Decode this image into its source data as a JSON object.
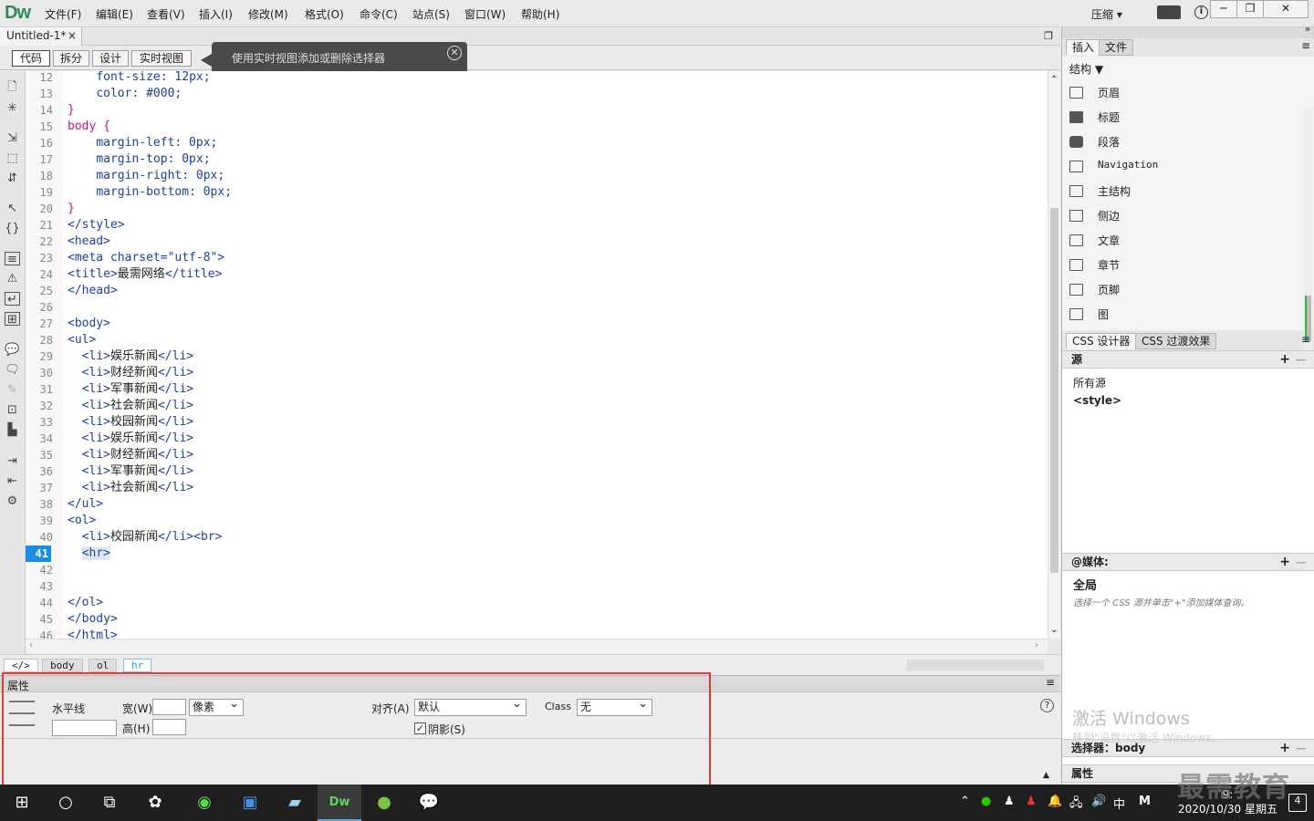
{
  "app": {
    "logo": "Dw"
  },
  "menu": [
    "文件(F)",
    "编辑(E)",
    "查看(V)",
    "插入(I)",
    "修改(M)",
    "格式(O)",
    "命令(C)",
    "站点(S)",
    "窗口(W)",
    "帮助(H)"
  ],
  "window": {
    "compress": "压缩",
    "compress_arrow": "▾",
    "min": "─",
    "max": "❐",
    "close": "✕"
  },
  "document": {
    "tab": "Untitled-1*",
    "tab_close": "×"
  },
  "viewbar": {
    "code": "代码",
    "split": "拆分",
    "design": "设计",
    "live": "实时视图"
  },
  "tooltip": {
    "text": "使用实时视图添加或删除选择器",
    "close": "✕"
  },
  "code_lines": [
    {
      "n": "12",
      "t": "    font-size: 12px;"
    },
    {
      "n": "13",
      "t": "    color: #000;"
    },
    {
      "n": "14",
      "t": "}"
    },
    {
      "n": "15",
      "t": "body {"
    },
    {
      "n": "16",
      "t": "    margin-left: 0px;"
    },
    {
      "n": "17",
      "t": "    margin-top: 0px;"
    },
    {
      "n": "18",
      "t": "    margin-right: 0px;"
    },
    {
      "n": "19",
      "t": "    margin-bottom: 0px;"
    },
    {
      "n": "20",
      "t": "}"
    },
    {
      "n": "21",
      "t": "</style>"
    },
    {
      "n": "22",
      "t": "<head>"
    },
    {
      "n": "23",
      "t": "<meta charset=\"utf-8\">"
    },
    {
      "n": "24",
      "t": "<title>最需网络</title>"
    },
    {
      "n": "25",
      "t": "</head>"
    },
    {
      "n": "26",
      "t": ""
    },
    {
      "n": "27",
      "t": "<body>"
    },
    {
      "n": "28",
      "t": "<ul>"
    },
    {
      "n": "29",
      "t": "  <li>娱乐新闻</li>"
    },
    {
      "n": "30",
      "t": "  <li>财经新闻</li>"
    },
    {
      "n": "31",
      "t": "  <li>军事新闻</li>"
    },
    {
      "n": "32",
      "t": "  <li>社会新闻</li>"
    },
    {
      "n": "33",
      "t": "  <li>校园新闻</li>"
    },
    {
      "n": "34",
      "t": "  <li>娱乐新闻</li>"
    },
    {
      "n": "35",
      "t": "  <li>财经新闻</li>"
    },
    {
      "n": "36",
      "t": "  <li>军事新闻</li>"
    },
    {
      "n": "37",
      "t": "  <li>社会新闻</li>"
    },
    {
      "n": "38",
      "t": "</ul>"
    },
    {
      "n": "39",
      "t": "<ol>"
    },
    {
      "n": "40",
      "t": "  <li>校园新闻</li><br>"
    },
    {
      "n": "41",
      "t": "  <hr>"
    },
    {
      "n": "42",
      "t": ""
    },
    {
      "n": "43",
      "t": ""
    },
    {
      "n": "44",
      "t": "</ol>"
    },
    {
      "n": "45",
      "t": "</body>"
    },
    {
      "n": "46",
      "t": "</html>"
    }
  ],
  "current_line": "41",
  "tagbar": {
    "code_icon": "</>",
    "tags": [
      "body",
      "ol",
      "hr"
    ]
  },
  "properties": {
    "title": "属性",
    "element": "水平线",
    "width_label": "宽(W)",
    "width_value": "",
    "unit": "像素",
    "height_label": "高(H)",
    "height_value": "",
    "name_value": "",
    "align_label": "对齐(A)",
    "align_value": "默认",
    "class_label": "Class",
    "class_value": "无",
    "shade_label": "阴影(S)",
    "shade_checked": true,
    "help": "?"
  },
  "right_panel": {
    "tabs": [
      "插入",
      "文件"
    ],
    "category": "结构",
    "items": [
      "页眉",
      "标题",
      "段落",
      "Navigation",
      "主结构",
      "侧边",
      "文章",
      "章节",
      "页脚",
      "图"
    ],
    "css_tabs": [
      "CSS 设计器",
      "CSS 过渡效果"
    ],
    "source_head": "源",
    "sources": [
      "所有源",
      "<style>"
    ],
    "media_head": "@媒体:",
    "media_global": "全局",
    "media_hint": "选择一个 CSS 源并单击\"+\"添加媒体查询。",
    "selector_head": "选择器：body",
    "props_head": "属性",
    "plus": "+",
    "minus": "—"
  },
  "activation": {
    "line1": "激活 Windows",
    "line2": "转到\"设置\"以激活 Windows。"
  },
  "watermark": "最需教育",
  "taskbar": {
    "clock_time": "9:",
    "clock_date": "2020/10/30 星期五",
    "ime": "中",
    "badge": "4"
  }
}
